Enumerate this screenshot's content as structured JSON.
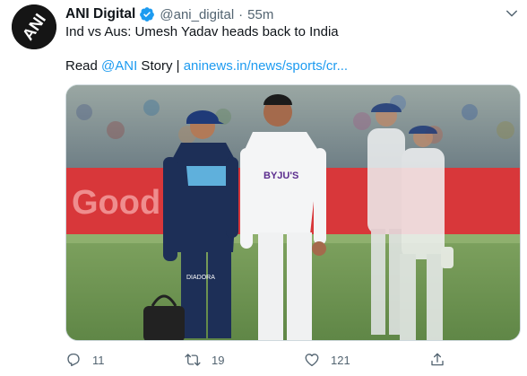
{
  "tweet": {
    "author": {
      "display_name": "ANI Digital",
      "handle": "@ani_digital",
      "verified": true,
      "avatar_text": "ANI"
    },
    "separator": "·",
    "time": "55m",
    "headline": "Ind vs Aus: Umesh Yadav heads back to India",
    "read_prefix": "Read ",
    "mention": "@ANI",
    "read_middle": " Story | ",
    "url": "aninews.in/news/sports/cr...",
    "media": {
      "board_text": "Good",
      "shirt_text_1": "BYJU'S",
      "bag_text": "DIADORA"
    },
    "actions": {
      "reply_count": "11",
      "retweet_count": "19",
      "like_count": "121"
    }
  },
  "colors": {
    "link": "#1d9bf0",
    "secondary_text": "#536471",
    "verified_badge": "#1d9bf0"
  }
}
